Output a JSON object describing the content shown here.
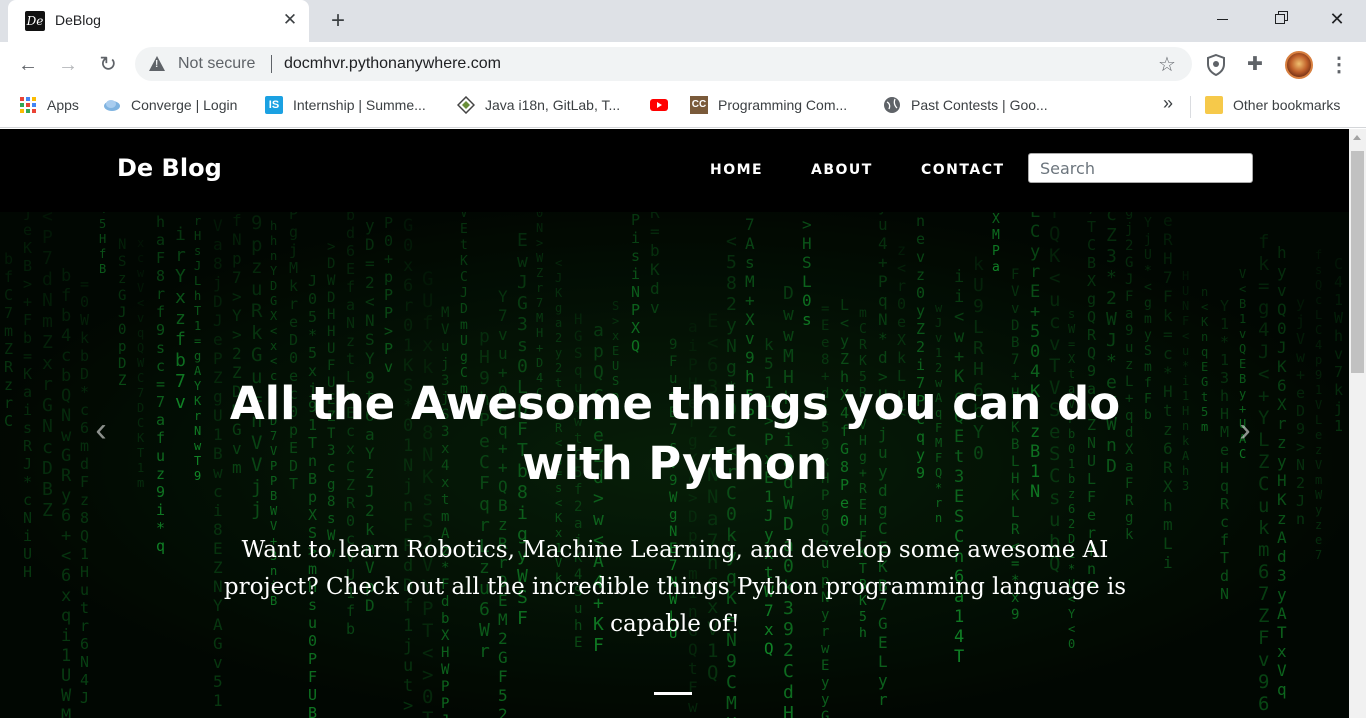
{
  "browser": {
    "tab": {
      "favicon_text": "De",
      "title": "DeBlog",
      "close": "✕"
    },
    "new_tab": "+",
    "window": {
      "minimize": "",
      "close": "✕"
    },
    "nav": {
      "back": "←",
      "forward": "→",
      "reload": "↻"
    },
    "omnibox": {
      "security": "Not secure",
      "url": "docmhvr.pythonanywhere.com"
    },
    "star": "☆",
    "puzzle": "✚",
    "menu": "⋮"
  },
  "bookmarks": {
    "items": [
      {
        "label": "Apps",
        "icon": "apps-grid-icon"
      },
      {
        "label": "Converge | Login",
        "icon": "cloud-icon"
      },
      {
        "label": "Internship | Summe...",
        "icon": "is-icon"
      },
      {
        "label": "Java i18n, GitLab, T...",
        "icon": "diamond-icon"
      },
      {
        "label": "",
        "icon": "youtube-icon"
      },
      {
        "label": "Programming Com...",
        "icon": "cc-icon"
      },
      {
        "label": "Past Contests | Goo...",
        "icon": "globe-icon"
      }
    ],
    "more": "»",
    "other": "Other bookmarks"
  },
  "site": {
    "brand": "De Blog",
    "nav": [
      "HOME",
      "ABOUT",
      "CONTACT"
    ],
    "search_placeholder": "Search",
    "hero": {
      "title": "All the Awesome things you can do with Python",
      "text": "Want to learn Robotics, Machine Learning, and develop some awesome AI project? Check out all the incredible things Python programming language is capable of!",
      "prev": "‹",
      "next": "›"
    }
  },
  "colors": {
    "matrix_green": "#19c43a",
    "tab_bar": "#dee1e6",
    "page_bg": "#000000"
  }
}
